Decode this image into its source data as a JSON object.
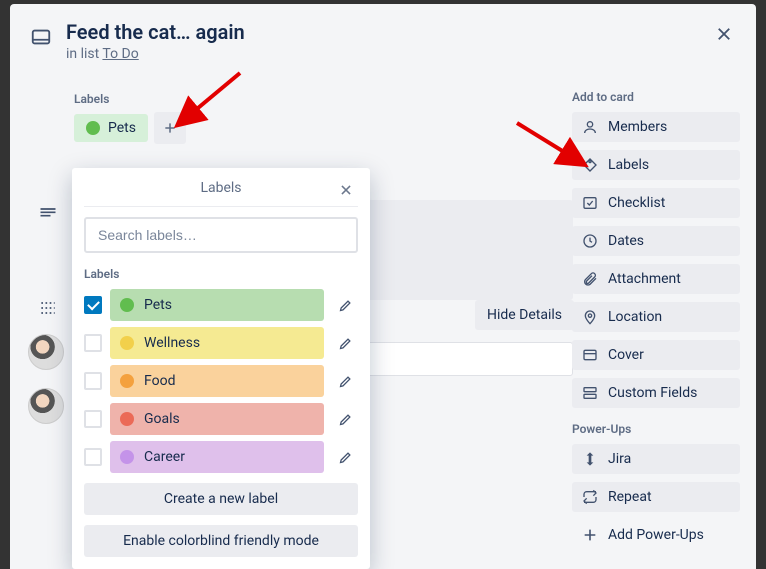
{
  "card": {
    "title": "Feed the cat… again",
    "subtitle_prefix": "in list ",
    "list_name": "To Do"
  },
  "labels_section": {
    "header": "Labels",
    "applied": [
      {
        "name": "Pets",
        "color_class": "dot-green",
        "chip_class": "chip-green"
      }
    ]
  },
  "popover": {
    "title": "Labels",
    "search_placeholder": "Search labels…",
    "section_label": "Labels",
    "labels": [
      {
        "name": "Pets",
        "pill_class": "lp-green",
        "dot_class": "dot-green",
        "checked": true
      },
      {
        "name": "Wellness",
        "pill_class": "lp-yellow",
        "dot_class": "dot-yellow",
        "checked": false
      },
      {
        "name": "Food",
        "pill_class": "lp-orange",
        "dot_class": "dot-orange",
        "checked": false
      },
      {
        "name": "Goals",
        "pill_class": "lp-red",
        "dot_class": "dot-red",
        "checked": false
      },
      {
        "name": "Career",
        "pill_class": "lp-purple",
        "dot_class": "dot-purple",
        "checked": false
      }
    ],
    "create_button": "Create a new label",
    "colorblind_button": "Enable colorblind friendly mode"
  },
  "sidebar": {
    "add_heading": "Add to card",
    "add_items": [
      {
        "key": "members",
        "label": "Members",
        "icon": "user"
      },
      {
        "key": "labels",
        "label": "Labels",
        "icon": "tag"
      },
      {
        "key": "checklist",
        "label": "Checklist",
        "icon": "check"
      },
      {
        "key": "dates",
        "label": "Dates",
        "icon": "clock"
      },
      {
        "key": "attachment",
        "label": "Attachment",
        "icon": "clip"
      },
      {
        "key": "location",
        "label": "Location",
        "icon": "pin"
      },
      {
        "key": "cover",
        "label": "Cover",
        "icon": "cover"
      },
      {
        "key": "custom-fields",
        "label": "Custom Fields",
        "icon": "fields"
      }
    ],
    "powerups_heading": "Power-Ups",
    "powerups": [
      {
        "key": "jira",
        "label": "Jira",
        "icon": "jira"
      },
      {
        "key": "repeat",
        "label": "Repeat",
        "icon": "repeat"
      }
    ],
    "add_powerups": "Add Power-Ups"
  },
  "hide_details": "Hide Details"
}
